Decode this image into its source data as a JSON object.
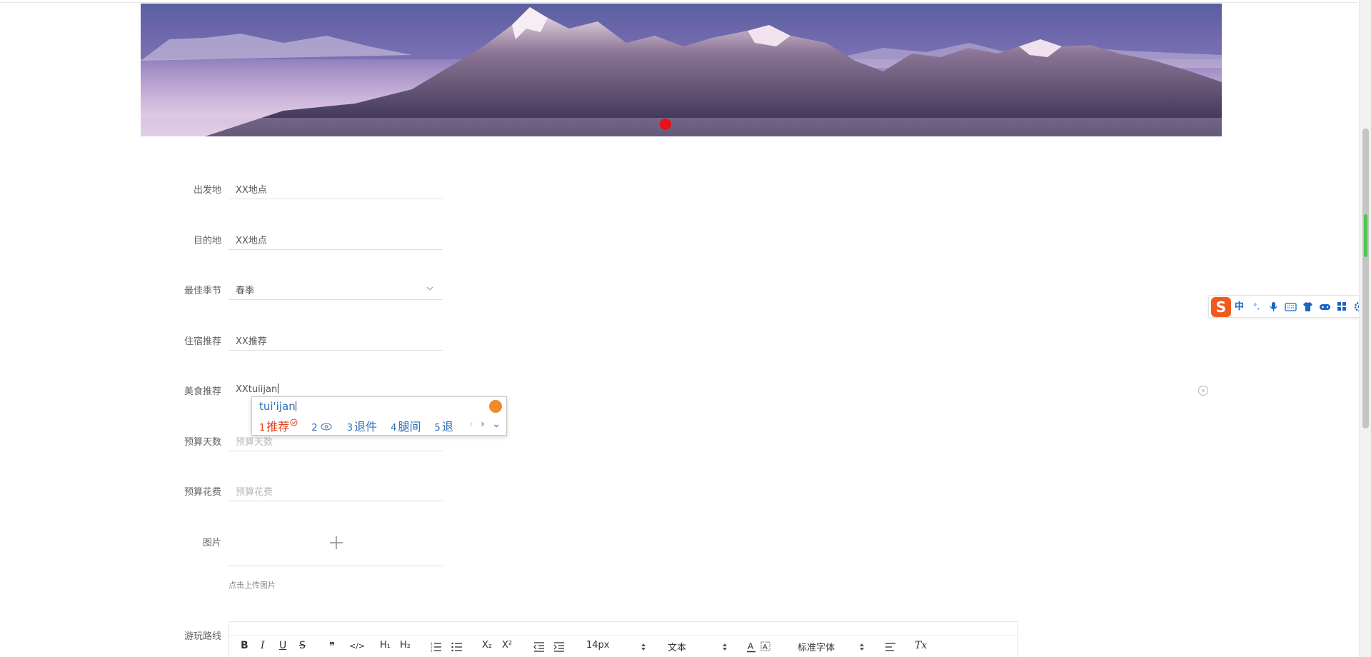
{
  "form": {
    "departure": {
      "label": "出发地",
      "value": "XX地点"
    },
    "destination": {
      "label": "目的地",
      "value": "XX地点"
    },
    "season": {
      "label": "最佳季节",
      "value": "春季"
    },
    "lodging": {
      "label": "住宿推荐",
      "value": "XX推荐"
    },
    "food": {
      "label": "美食推荐",
      "value": "XXtuiijan"
    },
    "days": {
      "label": "预算天数",
      "placeholder": "预算天数"
    },
    "cost": {
      "label": "预算花费",
      "placeholder": "预算花费"
    },
    "images": {
      "label": "图片",
      "hint": "点击上传图片"
    },
    "route": {
      "label": "游玩路线"
    }
  },
  "ime": {
    "pinyin": "tui'ijan",
    "candidates": [
      {
        "num": "1",
        "text": "推荐"
      },
      {
        "num": "2",
        "text": ""
      },
      {
        "num": "3",
        "text": "退件"
      },
      {
        "num": "4",
        "text": "腿间"
      },
      {
        "num": "5",
        "text": "退"
      }
    ],
    "toolbar": {
      "logo": "S",
      "lang": "中",
      "punct": "°,"
    }
  },
  "editor": {
    "font_size": "14px",
    "block_type": "文本",
    "font_family": "标准字体",
    "tools": {
      "bold": "B",
      "italic": "I",
      "underline": "U",
      "strike": "S",
      "quote": "❞",
      "code": "</>",
      "h1": "H₁",
      "h2": "H₂",
      "subscript": "X₂",
      "superscript": "X²",
      "clear_format": "Tx"
    }
  },
  "colors": {
    "accent": "#2c6fb7",
    "active_candidate": "#e0431c",
    "banner_dot": "#e8101a"
  }
}
